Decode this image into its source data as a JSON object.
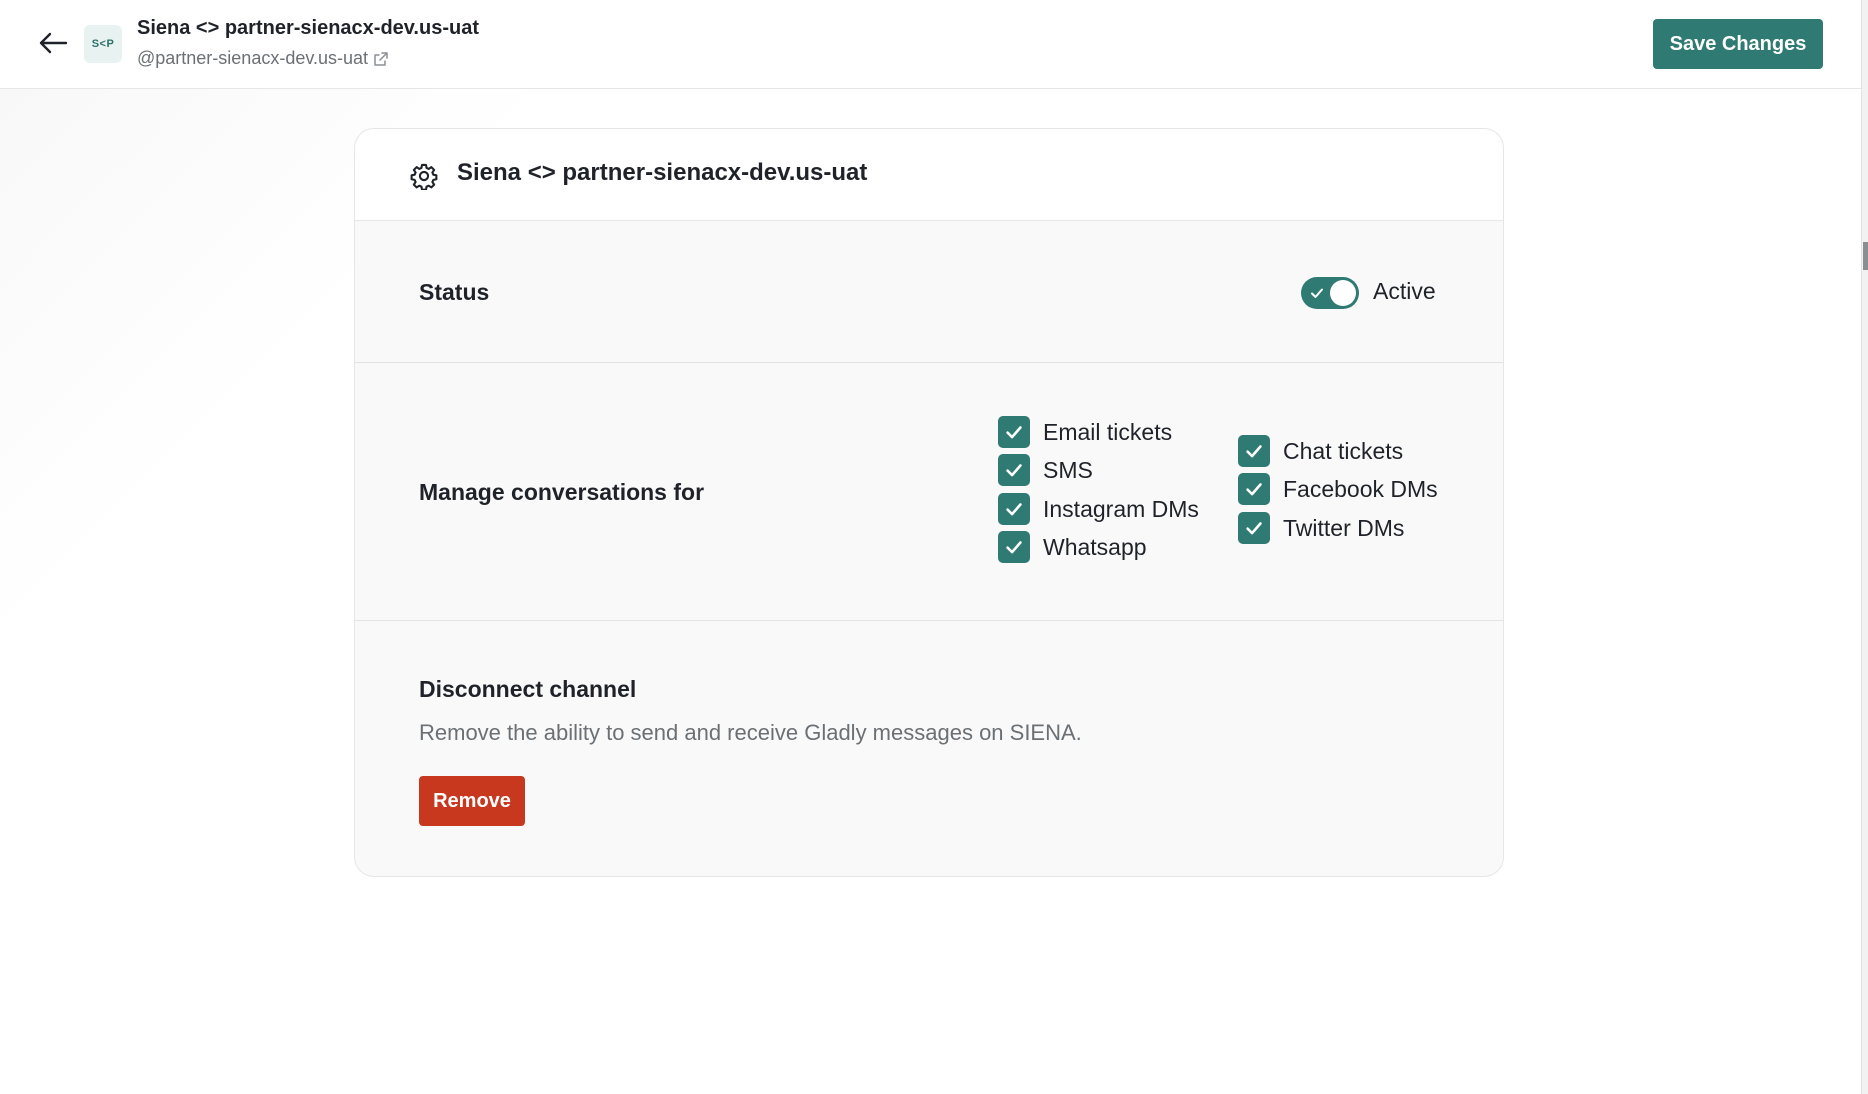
{
  "header": {
    "title": "Siena <> partner-sienacx-dev.us-uat",
    "subtitle": "@partner-sienacx-dev.us-uat",
    "logo_text": "S<P",
    "save_label": "Save Changes"
  },
  "card": {
    "title": "Siena <> partner-sienacx-dev.us-uat",
    "status": {
      "label": "Status",
      "toggle_label": "Active",
      "enabled": true
    },
    "conversations": {
      "label": "Manage conversations for",
      "options": [
        {
          "label": "Email tickets",
          "checked": true
        },
        {
          "label": "SMS",
          "checked": true
        },
        {
          "label": "Instagram DMs",
          "checked": true
        },
        {
          "label": "Whatsapp",
          "checked": true
        },
        {
          "label": "Chat tickets",
          "checked": true
        },
        {
          "label": "Facebook DMs",
          "checked": true
        },
        {
          "label": "Twitter DMs",
          "checked": true
        }
      ]
    },
    "disconnect": {
      "title": "Disconnect channel",
      "description": "Remove the ability to send and receive Gladly messages on SIENA.",
      "remove_label": "Remove"
    }
  },
  "colors": {
    "accent": "#2f7a72",
    "danger": "#c8381f",
    "muted_text": "#6b7075"
  },
  "icons": {
    "back": "arrow-left-icon",
    "external": "external-link-icon",
    "settings": "gear-icon",
    "check": "check-icon"
  }
}
